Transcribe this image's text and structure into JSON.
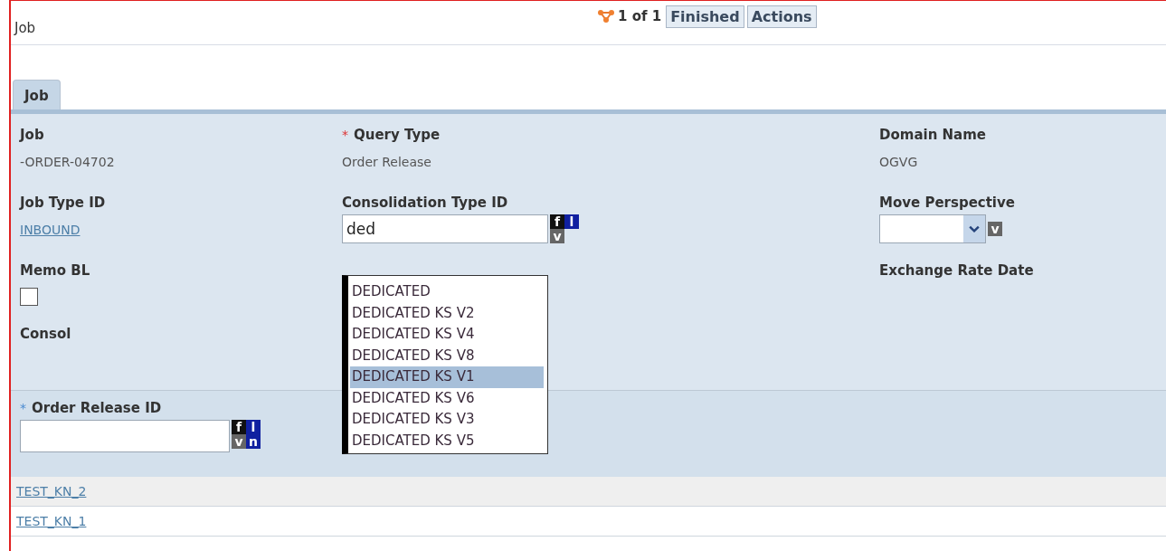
{
  "header": {
    "title": "Job",
    "record_count": "1 of 1",
    "buttons": [
      "Finished",
      "Actions"
    ]
  },
  "tabs": [
    {
      "label": "Job",
      "selected": true
    }
  ],
  "columns": [
    [
      {
        "kind": "text",
        "label": "Job",
        "value": "-ORDER-04702"
      },
      {
        "kind": "link",
        "label": "Job Type ID",
        "value": "INBOUND"
      },
      {
        "kind": "checkbox",
        "label": "Memo BL",
        "checked": false
      },
      {
        "kind": "label",
        "label": "Consol"
      }
    ],
    [
      {
        "kind": "text",
        "label": "Query Type",
        "required_mark": "*",
        "value": "Order Release"
      },
      {
        "kind": "lookup",
        "label": "Consolidation Type ID",
        "value": "ded",
        "keys": [
          "f",
          "l",
          "v"
        ],
        "suggestions": [
          {
            "label": "DEDICATED",
            "selected": false
          },
          {
            "label": "DEDICATED KS V2",
            "selected": false
          },
          {
            "label": "DEDICATED KS V4",
            "selected": false
          },
          {
            "label": "DEDICATED KS V8",
            "selected": false
          },
          {
            "label": "DEDICATED KS V1",
            "selected": true
          },
          {
            "label": "DEDICATED KS V6",
            "selected": false
          },
          {
            "label": "DEDICATED KS V3",
            "selected": false
          },
          {
            "label": "DEDICATED KS V5",
            "selected": false
          }
        ]
      }
    ],
    [
      {
        "kind": "text",
        "label": "Domain Name",
        "value": "OGVG"
      },
      {
        "kind": "select",
        "label": "Move Perspective",
        "keys": [
          "v"
        ]
      },
      {
        "kind": "label",
        "label": "Exchange Rate Date"
      }
    ]
  ],
  "order_release": {
    "label": "Order Release ID",
    "required_mark": "*",
    "keys": [
      "f",
      "l",
      "v",
      "n"
    ],
    "rows": [
      "TEST_KN_2",
      "TEST_KN_1"
    ]
  }
}
